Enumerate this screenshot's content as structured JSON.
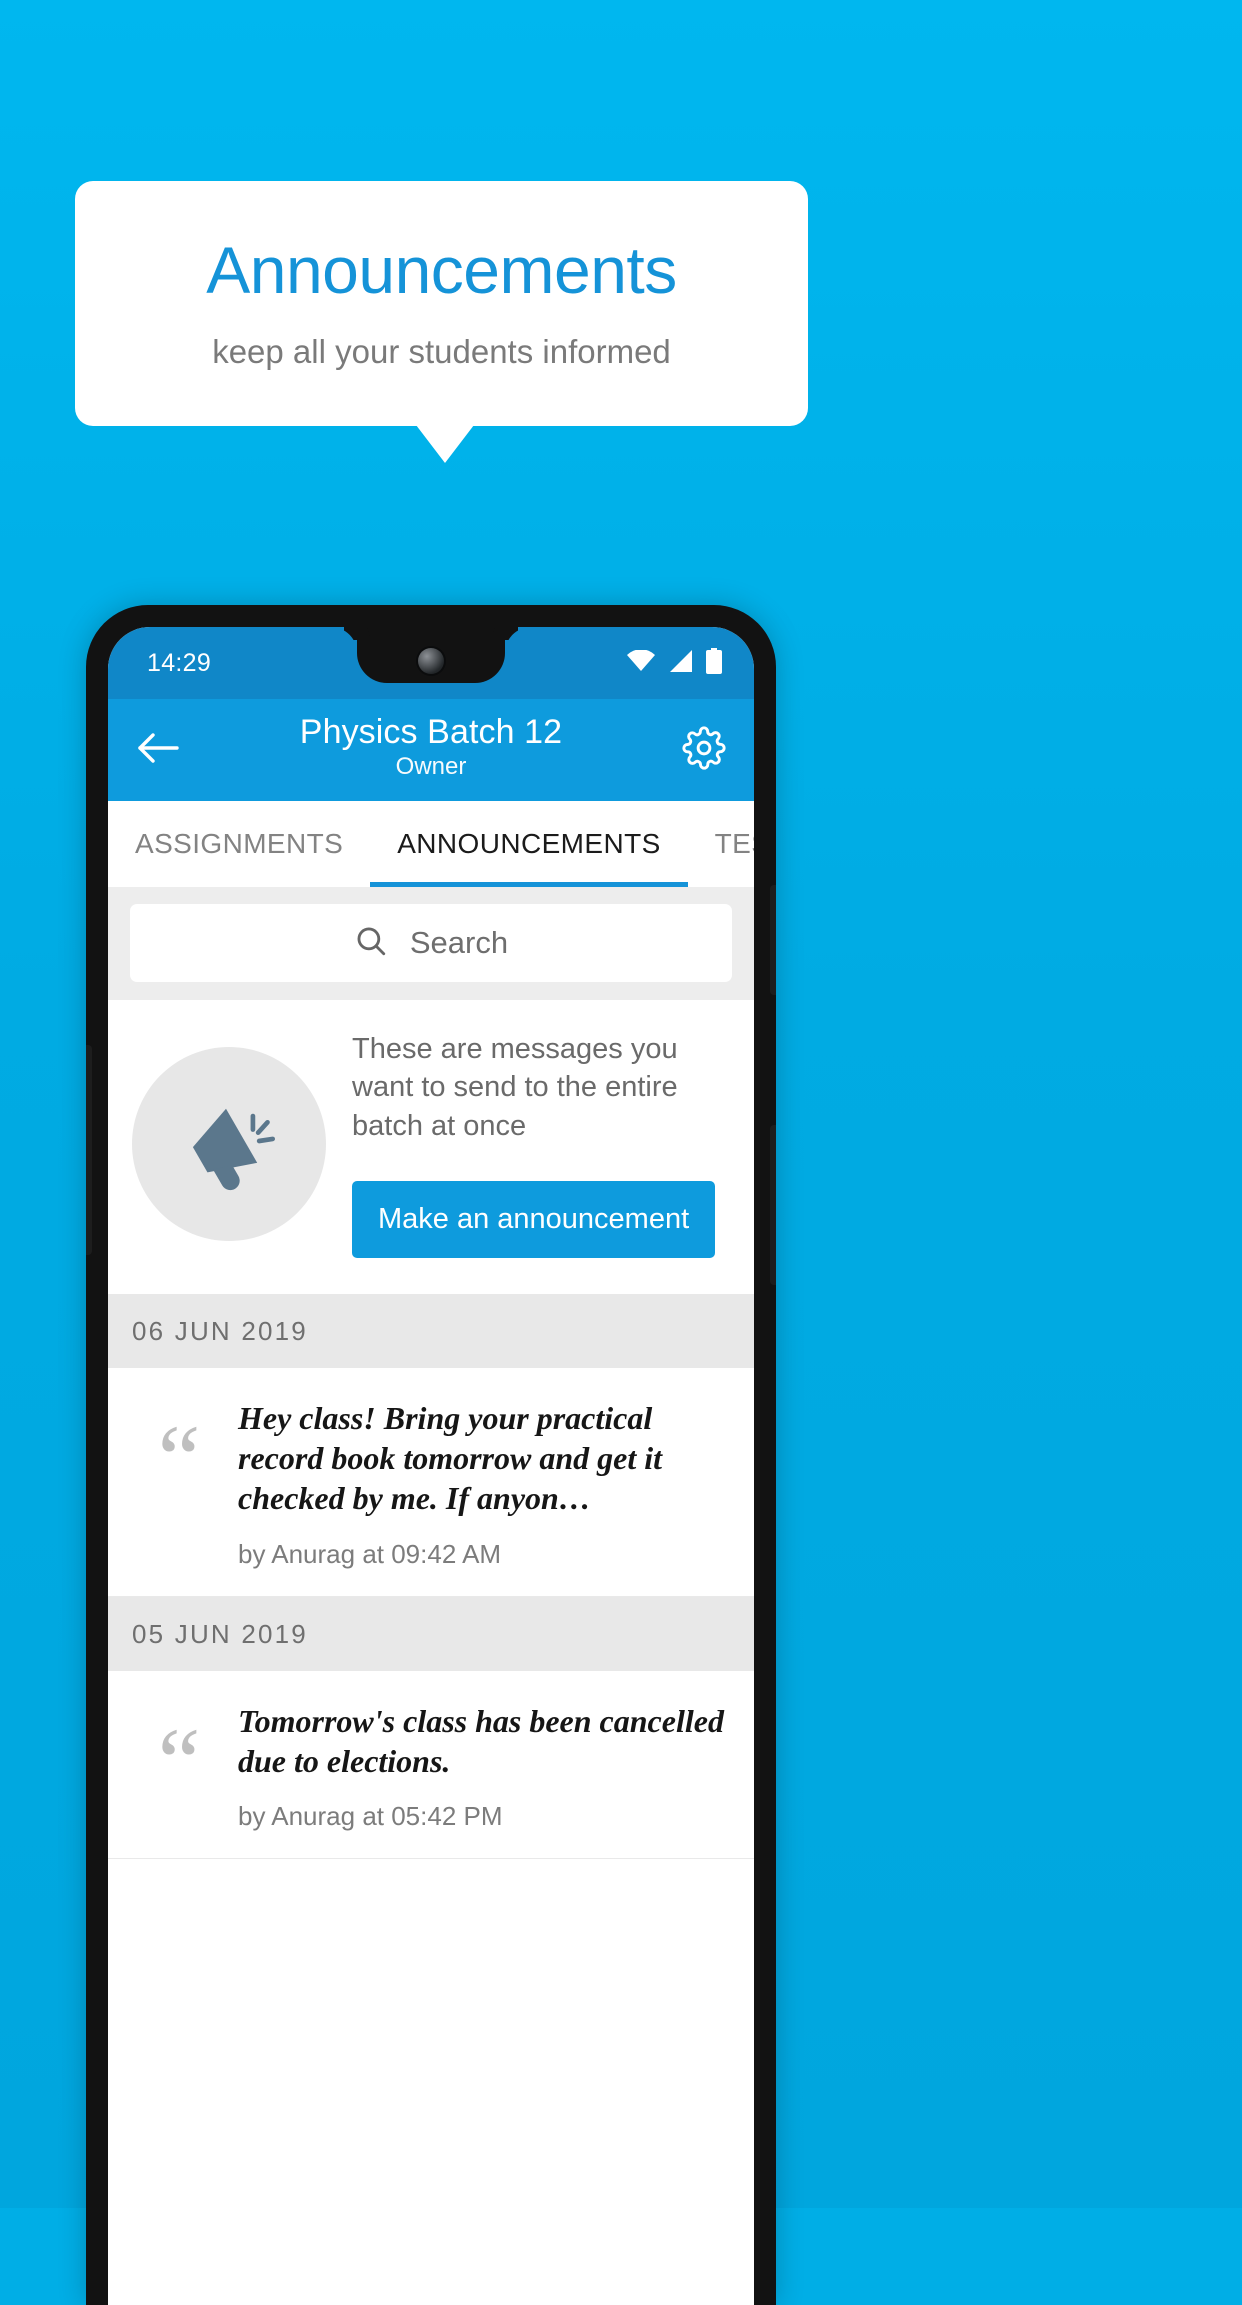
{
  "promo": {
    "title": "Announcements",
    "subtitle": "keep all your students informed",
    "bg_color": "#00ADE3",
    "title_color": "#1593D8"
  },
  "phone": {
    "statusbar": {
      "time": "14:29",
      "icons": [
        "wifi-icon",
        "signal-icon",
        "battery-icon"
      ]
    },
    "appbar": {
      "back_icon": "arrow-left-icon",
      "title": "Physics Batch 12",
      "subtitle": "Owner",
      "settings_icon": "gear-icon",
      "color": "#0E9BDD"
    },
    "tabs": [
      {
        "label": "ASSIGNMENTS",
        "active": false
      },
      {
        "label": "ANNOUNCEMENTS",
        "active": true
      },
      {
        "label": "TESTS",
        "active": false
      },
      {
        "label": "’",
        "active": false
      }
    ],
    "search": {
      "icon": "search-icon",
      "placeholder": "Search",
      "value": ""
    },
    "promo_card": {
      "icon": "megaphone-icon",
      "description": "These are messages you want to send to the entire batch at once",
      "button_label": "Make an announcement"
    },
    "groups": [
      {
        "date": "06  JUN  2019",
        "items": [
          {
            "quote_icon": "quote-icon",
            "text": "Hey class! Bring your practical record book tomorrow and get it checked by me. If anyon…",
            "meta": "by Anurag at 09:42 AM"
          }
        ]
      },
      {
        "date": "05  JUN  2019",
        "items": [
          {
            "quote_icon": "quote-icon",
            "text": "Tomorrow's class has been cancelled due to elections.",
            "meta": "by Anurag at 05:42 PM"
          }
        ]
      }
    ]
  }
}
